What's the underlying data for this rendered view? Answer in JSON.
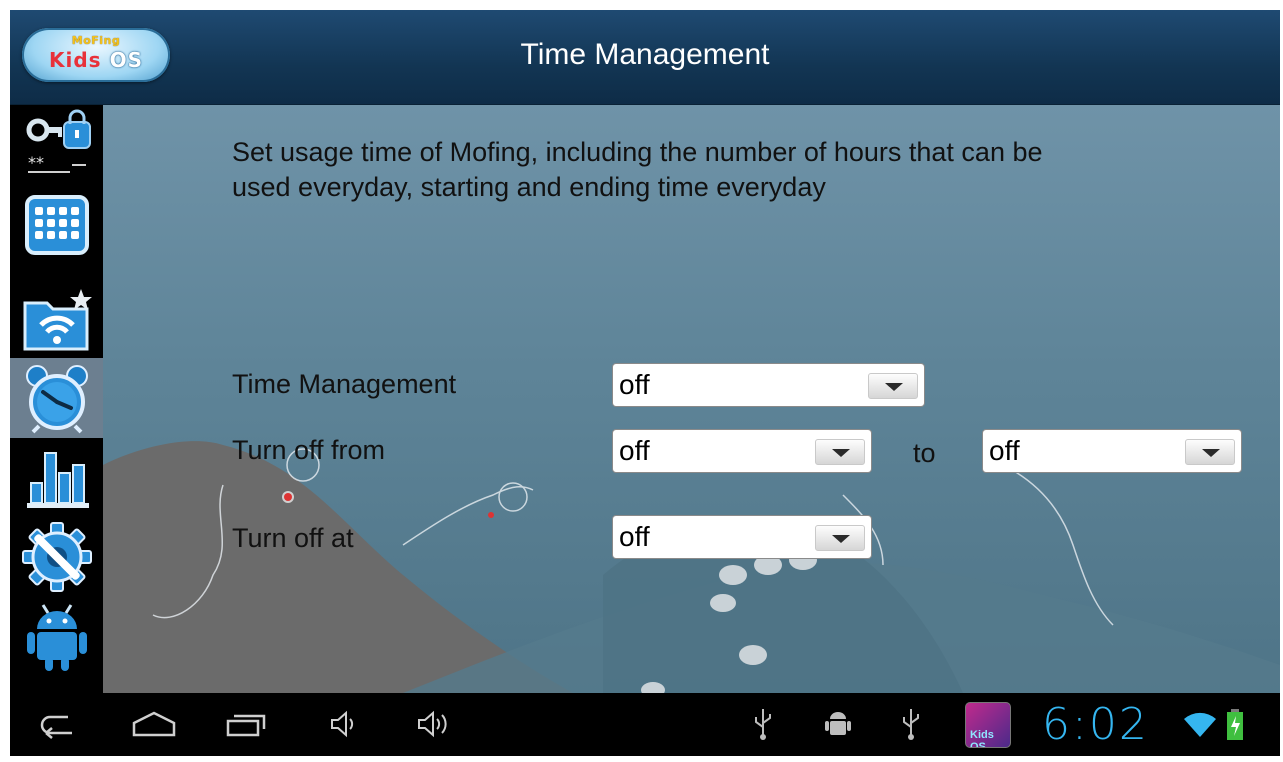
{
  "app": {
    "logo": {
      "brand_top": "MoFing",
      "brand_k": "Kids",
      "brand_os": "OS"
    },
    "title": "Time Management"
  },
  "sidebar": {
    "items": [
      {
        "icon": "key-lock-password-icon",
        "active": false
      },
      {
        "icon": "apps-grid-icon",
        "active": false
      },
      {
        "icon": "wifi-folder-icon",
        "active": false
      },
      {
        "icon": "alarm-clock-icon",
        "active": true
      },
      {
        "icon": "bar-chart-icon",
        "active": false
      },
      {
        "icon": "settings-wrench-icon",
        "active": false
      },
      {
        "icon": "android-robot-icon",
        "active": false
      }
    ]
  },
  "main": {
    "description": "Set usage time of Mofing, including the number of hours that can be used everyday, starting and ending time everyday",
    "time_management": {
      "label": "Time Management",
      "value": "off"
    },
    "turn_off_from": {
      "label": "Turn off from",
      "from_value": "off",
      "to_label": "to",
      "to_value": "off"
    },
    "turn_off_at": {
      "label": "Turn off at",
      "value": "off"
    }
  },
  "statusbar": {
    "app_thumb_label": "Kids OS",
    "time": "6:02",
    "colors": {
      "clock": "#35b6f0",
      "battery": "#3fbf3f"
    }
  },
  "colors": {
    "titlebar": "#123553",
    "content_bg": "#5e8498",
    "active_sidebar": "#6c7f90"
  }
}
